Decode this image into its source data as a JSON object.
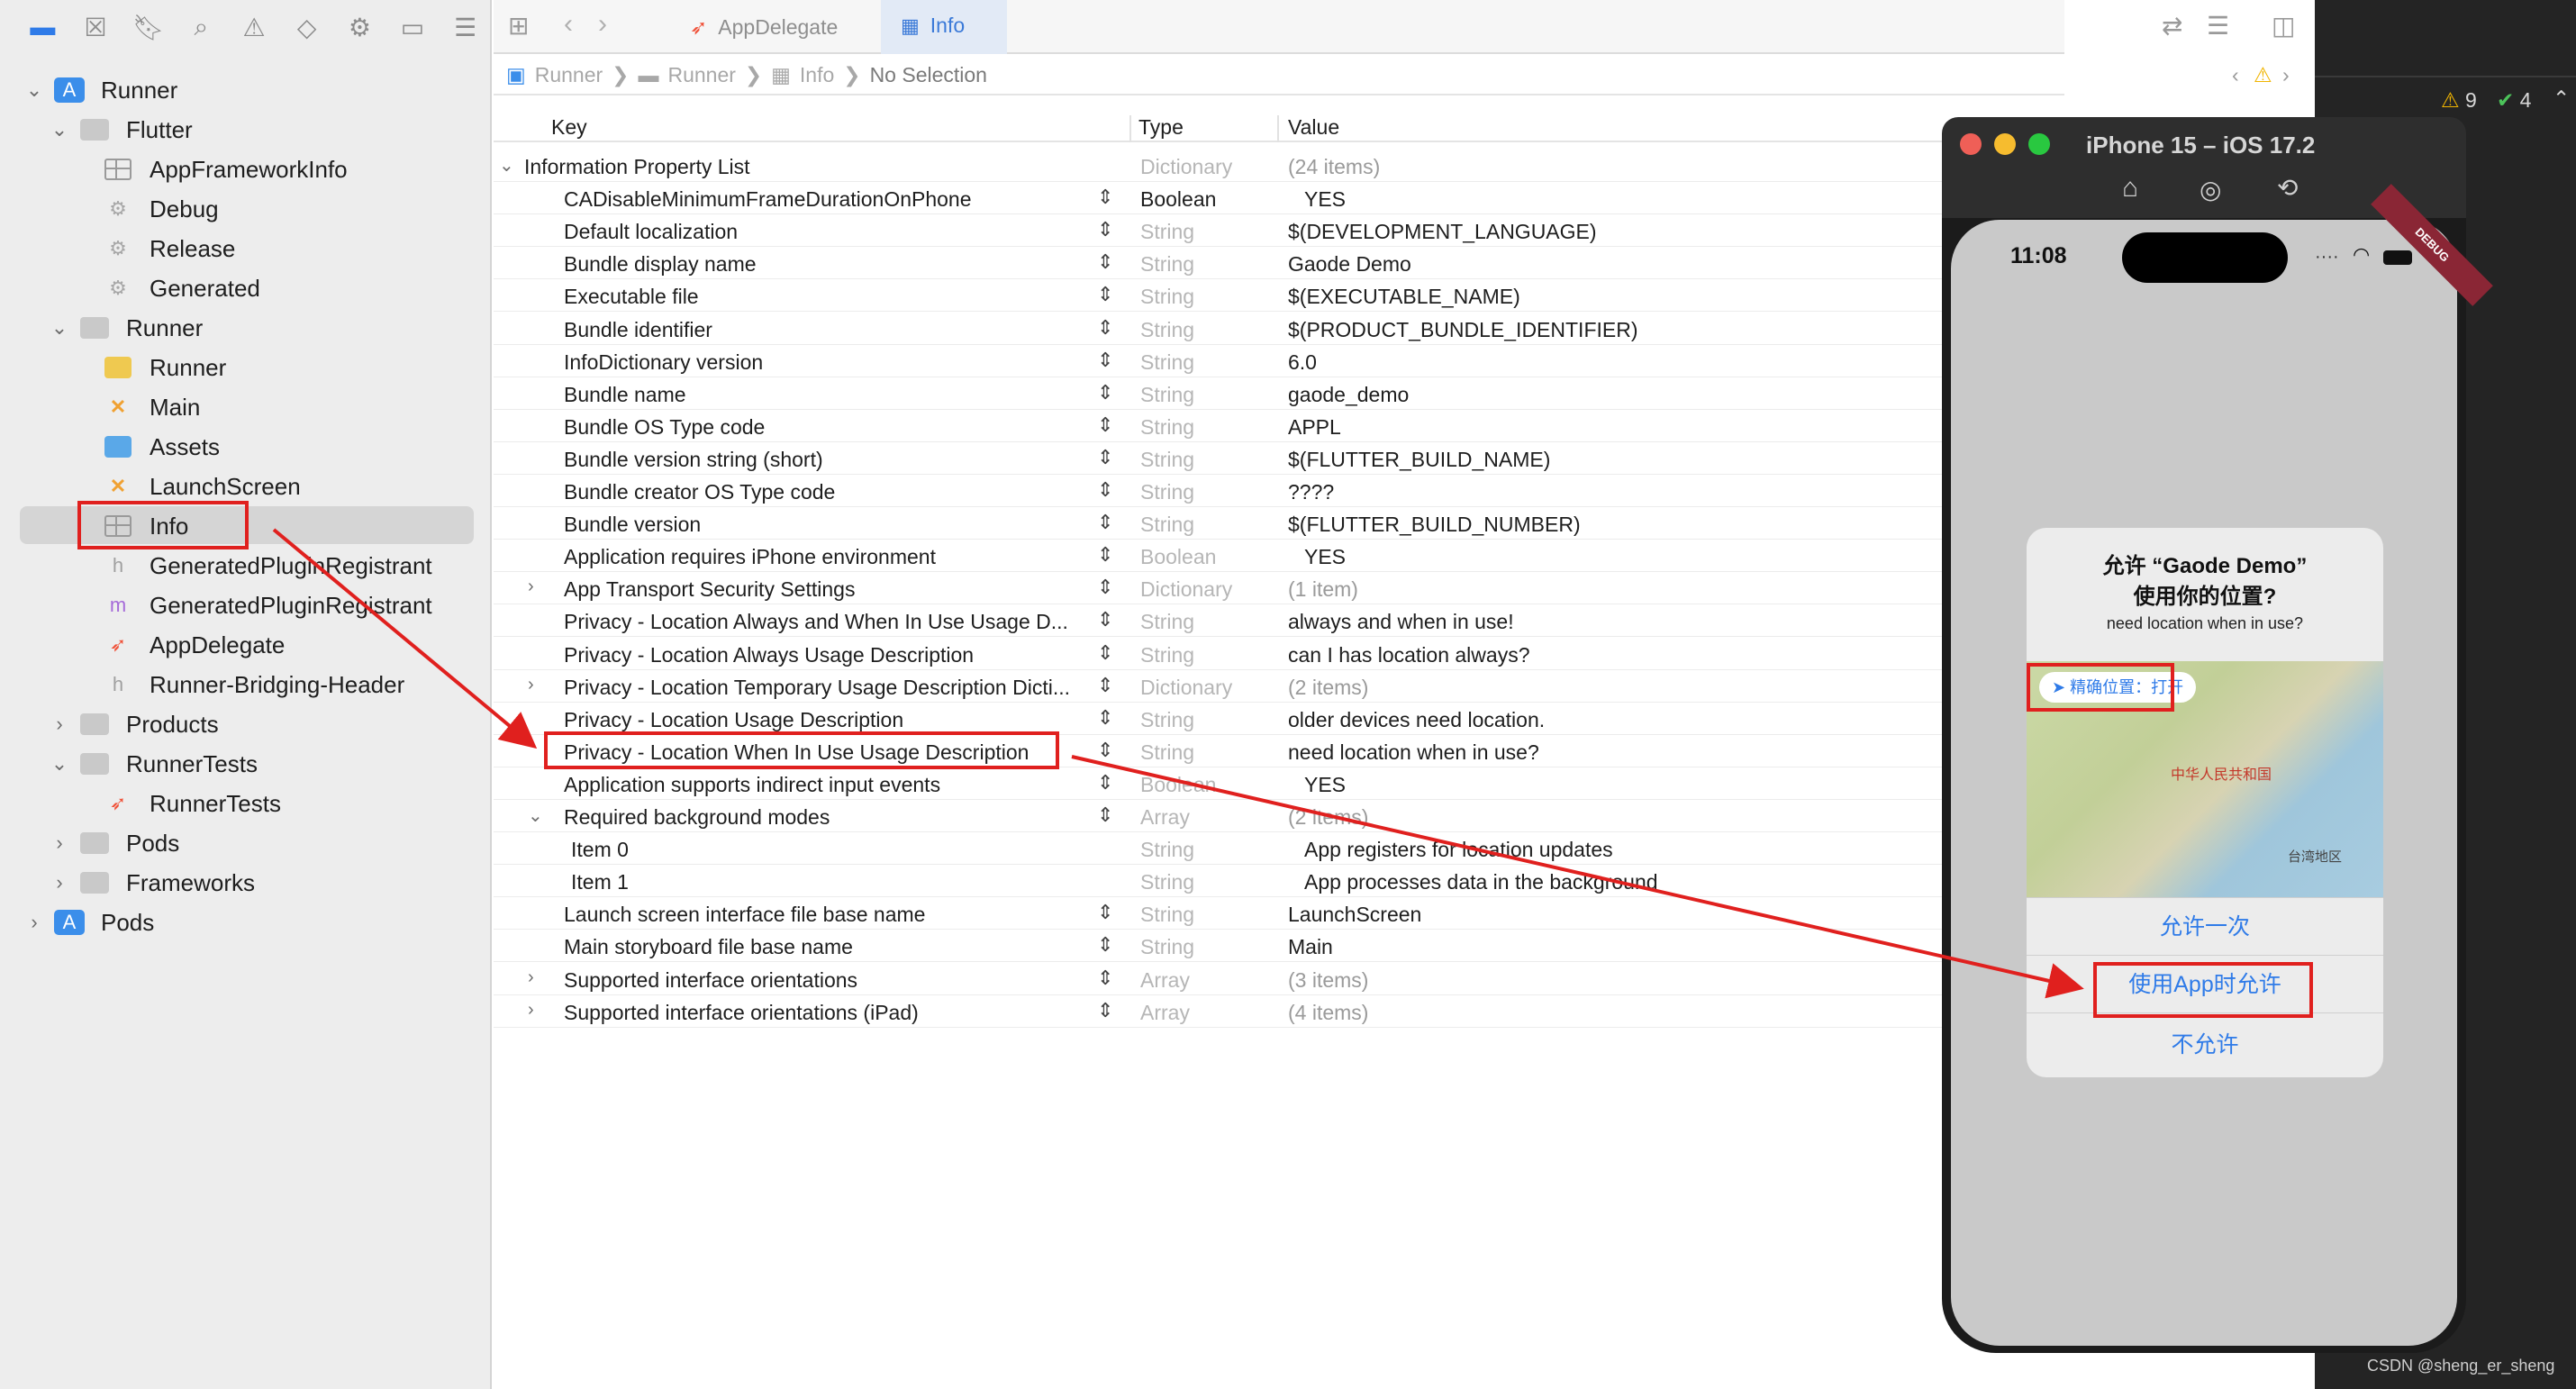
{
  "nav_toolbar": {
    "icons": [
      "folder-icon",
      "source-control-icon",
      "bookmark-icon",
      "find-icon",
      "issue-icon",
      "test-icon",
      "debug-icon",
      "breakpoint-icon",
      "report-icon"
    ]
  },
  "editor_toolbar": {
    "tabs": [
      {
        "label": "AppDelegate"
      },
      {
        "label": "Info"
      }
    ]
  },
  "jump_bar": {
    "items": [
      "Runner",
      "Runner",
      "Info",
      "No Selection"
    ],
    "separator": "❯"
  },
  "sidebar": {
    "items": [
      {
        "label": "Runner",
        "icon": "project-icon",
        "chevron": "open"
      },
      {
        "label": "Flutter",
        "icon": "folder-icon",
        "chevron": "open"
      },
      {
        "label": "AppFrameworkInfo",
        "icon": "plist-icon"
      },
      {
        "label": "Debug",
        "icon": "xcconfig-icon"
      },
      {
        "label": "Release",
        "icon": "xcconfig-icon"
      },
      {
        "label": "Generated",
        "icon": "xcconfig-icon"
      },
      {
        "label": "Runner",
        "icon": "folder-icon",
        "chevron": "open"
      },
      {
        "label": "Runner",
        "icon": "entitlements-icon"
      },
      {
        "label": "Main",
        "icon": "storyboard-icon"
      },
      {
        "label": "Assets",
        "icon": "assets-icon"
      },
      {
        "label": "LaunchScreen",
        "icon": "storyboard-icon"
      },
      {
        "label": "Info",
        "icon": "plist-icon"
      },
      {
        "label": "GeneratedPluginRegistrant",
        "icon": "h-file-icon"
      },
      {
        "label": "GeneratedPluginRegistrant",
        "icon": "m-file-icon"
      },
      {
        "label": "AppDelegate",
        "icon": "swift-icon"
      },
      {
        "label": "Runner-Bridging-Header",
        "icon": "h-file-icon"
      },
      {
        "label": "Products",
        "icon": "folder-icon",
        "chevron": "closed"
      },
      {
        "label": "RunnerTests",
        "icon": "folder-icon",
        "chevron": "open"
      },
      {
        "label": "RunnerTests",
        "icon": "swift-icon"
      },
      {
        "label": "Pods",
        "icon": "folder-icon",
        "chevron": "closed"
      },
      {
        "label": "Frameworks",
        "icon": "folder-icon",
        "chevron": "closed"
      },
      {
        "label": "Pods",
        "icon": "project-icon",
        "chevron": "closed"
      }
    ]
  },
  "plist": {
    "headers": {
      "key": "Key",
      "type": "Type",
      "value": "Value"
    },
    "rows": [
      {
        "key": "Information Property List",
        "type": "Dictionary",
        "value": "(24 items)",
        "disclosure": "open"
      },
      {
        "key": "CADisableMinimumFrameDurationOnPhone",
        "type": "Boolean",
        "value": "YES"
      },
      {
        "key": "Default localization",
        "type": "String",
        "value": "$(DEVELOPMENT_LANGUAGE)"
      },
      {
        "key": "Bundle display name",
        "type": "String",
        "value": "Gaode Demo"
      },
      {
        "key": "Executable file",
        "type": "String",
        "value": "$(EXECUTABLE_NAME)"
      },
      {
        "key": "Bundle identifier",
        "type": "String",
        "value": "$(PRODUCT_BUNDLE_IDENTIFIER)"
      },
      {
        "key": "InfoDictionary version",
        "type": "String",
        "value": "6.0"
      },
      {
        "key": "Bundle name",
        "type": "String",
        "value": "gaode_demo"
      },
      {
        "key": "Bundle OS Type code",
        "type": "String",
        "value": "APPL"
      },
      {
        "key": "Bundle version string (short)",
        "type": "String",
        "value": "$(FLUTTER_BUILD_NAME)"
      },
      {
        "key": "Bundle creator OS Type code",
        "type": "String",
        "value": "????"
      },
      {
        "key": "Bundle version",
        "type": "String",
        "value": "$(FLUTTER_BUILD_NUMBER)"
      },
      {
        "key": "Application requires iPhone environment",
        "type": "Boolean",
        "value": "YES"
      },
      {
        "key": "App Transport Security Settings",
        "type": "Dictionary",
        "value": "(1 item)",
        "disclosure": "closed"
      },
      {
        "key": "Privacy - Location Always and When In Use Usage D...",
        "type": "String",
        "value": "always and when in use!"
      },
      {
        "key": "Privacy - Location Always Usage Description",
        "type": "String",
        "value": "can I has location always?"
      },
      {
        "key": "Privacy - Location Temporary Usage Description Dicti...",
        "type": "Dictionary",
        "value": "(2 items)",
        "disclosure": "closed"
      },
      {
        "key": "Privacy - Location Usage Description",
        "type": "String",
        "value": "older devices need location."
      },
      {
        "key": "Privacy - Location When In Use Usage Description",
        "type": "String",
        "value": "need location when in use?"
      },
      {
        "key": "Application supports indirect input events",
        "type": "Boolean",
        "value": "YES"
      },
      {
        "key": "Required background modes",
        "type": "Array",
        "value": "(2 items)",
        "disclosure": "open"
      },
      {
        "key": "Item 0",
        "type": "String",
        "value": "App registers for location updates"
      },
      {
        "key": "Item 1",
        "type": "String",
        "value": "App processes data in the background"
      },
      {
        "key": "Launch screen interface file base name",
        "type": "String",
        "value": "LaunchScreen"
      },
      {
        "key": "Main storyboard file base name",
        "type": "String",
        "value": "Main"
      },
      {
        "key": "Supported interface orientations",
        "type": "Array",
        "value": "(3 items)",
        "disclosure": "closed"
      },
      {
        "key": "Supported interface orientations (iPad)",
        "type": "Array",
        "value": "(4 items)",
        "disclosure": "closed"
      }
    ]
  },
  "status": {
    "warnings": "9",
    "successes": "4"
  },
  "simulator": {
    "title": "iPhone 15 – iOS 17.2",
    "time": "11:08",
    "debug_badge": "DEBUG",
    "alert": {
      "title": "允许 “Gaode Demo” 使用你的位置?",
      "message": "need location when in use?",
      "precise_chip": "精确位置：打开",
      "map_label_1": "中华人民共和国",
      "map_label_2": "台湾地区",
      "buttons": [
        "允许一次",
        "使用App时允许",
        "不允许"
      ]
    }
  },
  "watermark": "CSDN @sheng_er_sheng",
  "colors": {
    "accent": "#2f7be8",
    "annotation": "#e0201e",
    "sidebar_bg": "#ededed"
  }
}
